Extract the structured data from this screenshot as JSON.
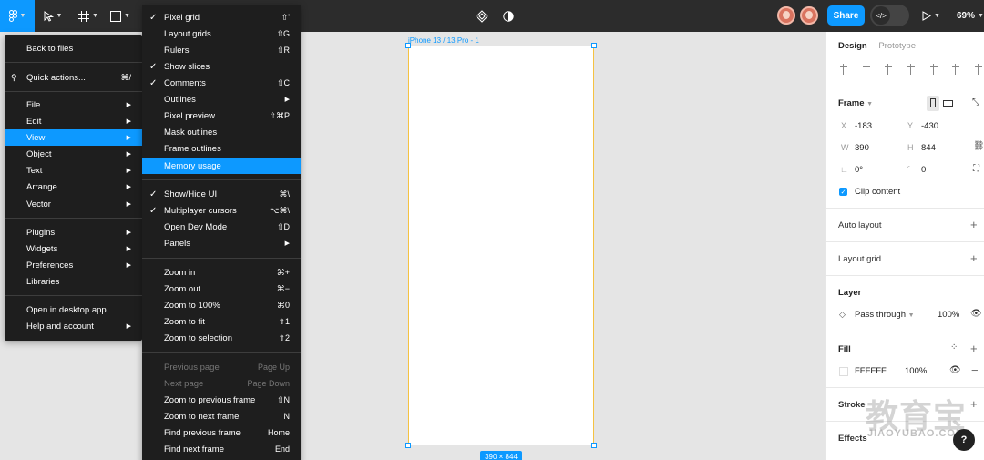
{
  "toolbar": {
    "logo_icon": "figma-logo-icon",
    "move_tool_icon": "cursor-arrow-icon",
    "frame_tool_icon": "hash-frame-icon",
    "shape_tool_icon": "rectangle-icon",
    "components_icon": "components-icon",
    "theme_icon": "half-circle-icon",
    "share_label": "Share",
    "dev_mode_icon": "code-icon",
    "play_icon": "play-icon",
    "zoom": "69%"
  },
  "canvas": {
    "frame_label": "iPhone 13 / 13 Pro - 1",
    "size_badge": "390 × 844",
    "frame_stroke_color": "#f5c242",
    "selection_color": "#0d99ff"
  },
  "main_menu": {
    "back": "Back to files",
    "quick_actions": "Quick actions...",
    "quick_actions_shortcut": "⌘/",
    "items": [
      "File",
      "Edit",
      "View",
      "Object",
      "Text",
      "Arrange",
      "Vector"
    ],
    "items2": [
      "Plugins",
      "Widgets",
      "Preferences",
      "Libraries"
    ],
    "open_desktop": "Open in desktop app",
    "help": "Help and account"
  },
  "view_menu": {
    "group1": [
      {
        "label": "Pixel grid",
        "check": "✓",
        "shortcut": "⇧'"
      },
      {
        "label": "Layout grids",
        "check": "",
        "shortcut": "⇧G"
      },
      {
        "label": "Rulers",
        "check": "",
        "shortcut": "⇧R"
      },
      {
        "label": "Show slices",
        "check": "✓",
        "shortcut": ""
      },
      {
        "label": "Comments",
        "check": "✓",
        "shortcut": "⇧C"
      },
      {
        "label": "Outlines",
        "check": "",
        "shortcut": "▶"
      },
      {
        "label": "Pixel preview",
        "check": "",
        "shortcut": "⇧⌘P"
      },
      {
        "label": "Mask outlines",
        "check": "",
        "shortcut": ""
      },
      {
        "label": "Frame outlines",
        "check": "",
        "shortcut": ""
      },
      {
        "label": "Memory usage",
        "check": "",
        "shortcut": ""
      }
    ],
    "group2": [
      {
        "label": "Show/Hide UI",
        "check": "✓",
        "shortcut": "⌘\\"
      },
      {
        "label": "Multiplayer cursors",
        "check": "✓",
        "shortcut": "⌥⌘\\"
      },
      {
        "label": "Open Dev Mode",
        "check": "",
        "shortcut": "⇧D"
      },
      {
        "label": "Panels",
        "check": "",
        "shortcut": "▶"
      }
    ],
    "group3": [
      {
        "label": "Zoom in",
        "shortcut": "⌘+"
      },
      {
        "label": "Zoom out",
        "shortcut": "⌘−"
      },
      {
        "label": "Zoom to 100%",
        "shortcut": "⌘0"
      },
      {
        "label": "Zoom to fit",
        "shortcut": "⇧1"
      },
      {
        "label": "Zoom to selection",
        "shortcut": "⇧2"
      }
    ],
    "group4": [
      {
        "label": "Previous page",
        "shortcut": "Page Up",
        "disabled": true
      },
      {
        "label": "Next page",
        "shortcut": "Page Down",
        "disabled": true
      },
      {
        "label": "Zoom to previous frame",
        "shortcut": "⇧N",
        "disabled": false
      },
      {
        "label": "Zoom to next frame",
        "shortcut": "N",
        "disabled": false
      },
      {
        "label": "Find previous frame",
        "shortcut": "Home",
        "disabled": false
      },
      {
        "label": "Find next frame",
        "shortcut": "End",
        "disabled": false
      }
    ]
  },
  "panel": {
    "tab_design": "Design",
    "tab_prototype": "Prototype",
    "frame_title": "Frame",
    "x_label": "X",
    "x_value": "-183",
    "y_label": "Y",
    "y_value": "-430",
    "w_label": "W",
    "w_value": "390",
    "h_label": "H",
    "h_value": "844",
    "rotation": "0°",
    "radius": "0",
    "clip_content": "Clip content",
    "auto_layout": "Auto layout",
    "layout_grid": "Layout grid",
    "layer_title": "Layer",
    "blend_mode": "Pass through",
    "layer_opacity": "100%",
    "fill_title": "Fill",
    "fill_hex": "FFFFFF",
    "fill_opacity": "100%",
    "stroke": "Stroke",
    "effects": "Effects"
  },
  "watermark": {
    "text": "教育宝",
    "sub": "JIAOYUBAO.COM"
  },
  "help_button": "?"
}
